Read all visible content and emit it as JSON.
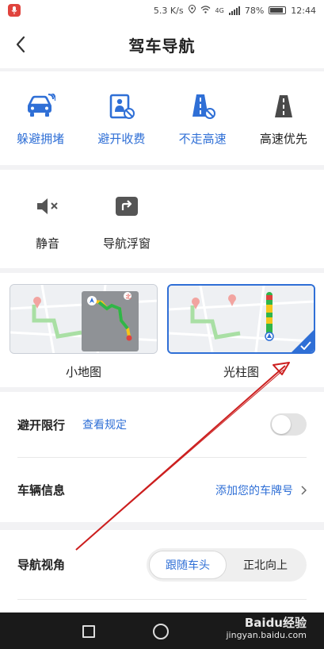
{
  "status_bar": {
    "speed": "5.3 K/s",
    "network": "4G",
    "battery": "78%",
    "time": "12:44"
  },
  "header": {
    "title": "驾车导航"
  },
  "route_prefs": [
    {
      "label": "躲避拥堵",
      "icon": "car-congestion-icon",
      "selected": true
    },
    {
      "label": "避开收费",
      "icon": "toll-icon",
      "selected": true
    },
    {
      "label": "不走高速",
      "icon": "no-highway-icon",
      "selected": true
    },
    {
      "label": "高速优先",
      "icon": "highway-icon",
      "selected": false
    }
  ],
  "tools": [
    {
      "label": "静音",
      "icon": "mute-icon"
    },
    {
      "label": "导航浮窗",
      "icon": "float-window-icon"
    }
  ],
  "map_modes": [
    {
      "label": "小地图",
      "selected": false
    },
    {
      "label": "光柱图",
      "selected": true
    }
  ],
  "rows": {
    "restriction": {
      "title": "避开限行",
      "link": "查看规定",
      "toggle_on": false
    },
    "vehicle": {
      "title": "车辆信息",
      "value": "添加您的车牌号"
    }
  },
  "view": {
    "title": "导航视角",
    "options": [
      "跟随车头",
      "正北向上"
    ],
    "selected": "跟随车头"
  },
  "watermark": {
    "brand": "Baidu经验",
    "url": "jingyan.baidu.com"
  },
  "colors": {
    "accent": "#2f6fd6",
    "annotation": "#cc1f1f"
  }
}
